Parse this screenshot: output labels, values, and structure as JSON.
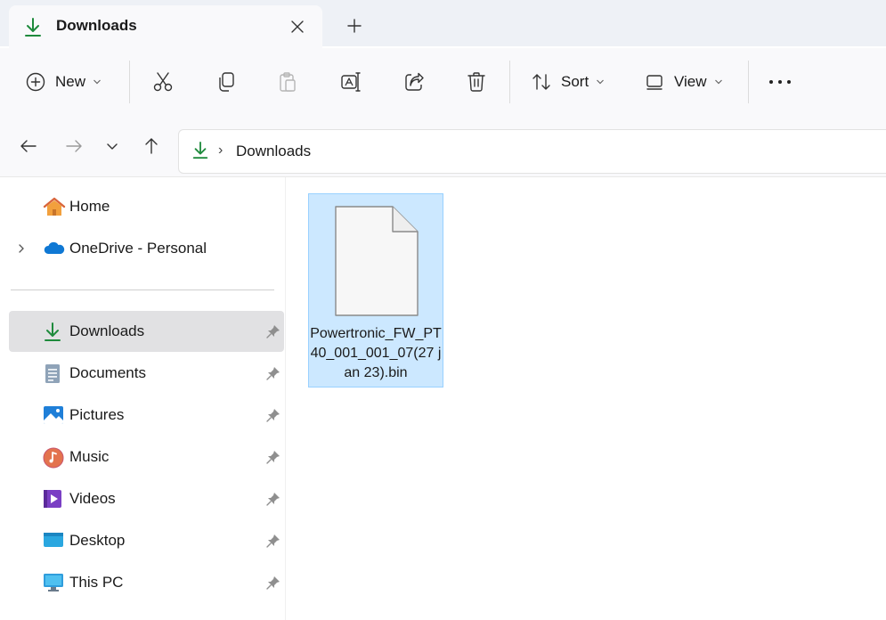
{
  "window": {
    "tab_title": "Downloads",
    "tab_icon": "download-arrow-icon",
    "close_tab_icon": "close-icon",
    "new_tab_icon": "plus-icon"
  },
  "toolbar": {
    "new_label": "New",
    "sort_label": "Sort",
    "view_label": "View",
    "icons": [
      "add-circle-icon",
      "cut-icon",
      "copy-icon",
      "paste-icon",
      "rename-icon",
      "share-icon",
      "delete-icon",
      "sort-arrows-icon",
      "view-icon",
      "more-icon"
    ]
  },
  "address": {
    "crumbs": [
      "Downloads"
    ],
    "separator": "›"
  },
  "sidebar": {
    "items": [
      {
        "label": "Home",
        "icon": "home-icon"
      },
      {
        "label": "OneDrive - Personal",
        "icon": "cloud-icon",
        "collapsed": true
      },
      {
        "label": "Downloads",
        "icon": "download-arrow-icon",
        "pinned": true,
        "selected": true
      },
      {
        "label": "Documents",
        "icon": "documents-icon",
        "pinned": true
      },
      {
        "label": "Pictures",
        "icon": "pictures-icon",
        "pinned": true
      },
      {
        "label": "Music",
        "icon": "music-icon",
        "pinned": true
      },
      {
        "label": "Videos",
        "icon": "videos-icon",
        "pinned": true
      },
      {
        "label": "Desktop",
        "icon": "desktop-icon",
        "pinned": true
      },
      {
        "label": "This PC",
        "icon": "pc-icon",
        "pinned": true
      }
    ]
  },
  "content": {
    "files": [
      {
        "name": "Powertronic_FW_PT40_001_001_07(27 jan 23).bin",
        "selected": true,
        "icon": "generic-file-icon"
      }
    ]
  },
  "colors": {
    "accent_download": "#1e8a3c",
    "selection_bg": "#cce8ff",
    "selection_border": "#99d1ff",
    "nav_selected_bg": "#e1e1e3"
  }
}
